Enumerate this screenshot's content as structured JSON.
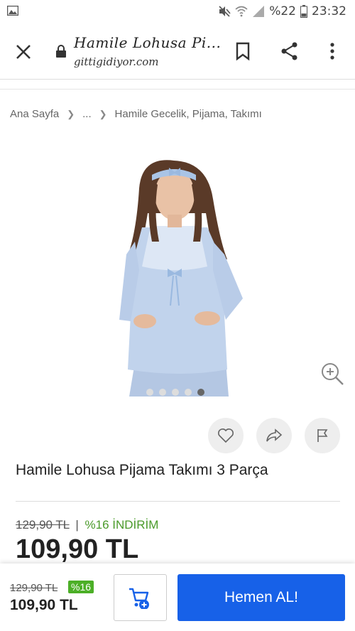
{
  "statusbar": {
    "battery": "%22",
    "time": "23:32"
  },
  "browser": {
    "title": "Hamile Lohusa Pi...",
    "host": "gittigidiyor.com"
  },
  "breadcrumb": {
    "items": [
      "Ana Sayfa",
      "...",
      "Hamile Gecelik, Pijama, Takımı"
    ]
  },
  "gallery": {
    "image_count": 5,
    "active_index": 4
  },
  "product": {
    "title": "Hamile Lohusa Pijama Takımı 3 Parça",
    "old_price": "129,90 TL",
    "discount": "%16 İNDİRİM",
    "price": "109,90 TL"
  },
  "bottom_bar": {
    "old_price": "129,90 TL",
    "badge": "%16",
    "price": "109,90 TL",
    "buy_label": "Hemen AL!"
  },
  "colors": {
    "accent": "#1761e8",
    "discount_green": "#4a9a2a",
    "badge_green": "#4caf27"
  }
}
